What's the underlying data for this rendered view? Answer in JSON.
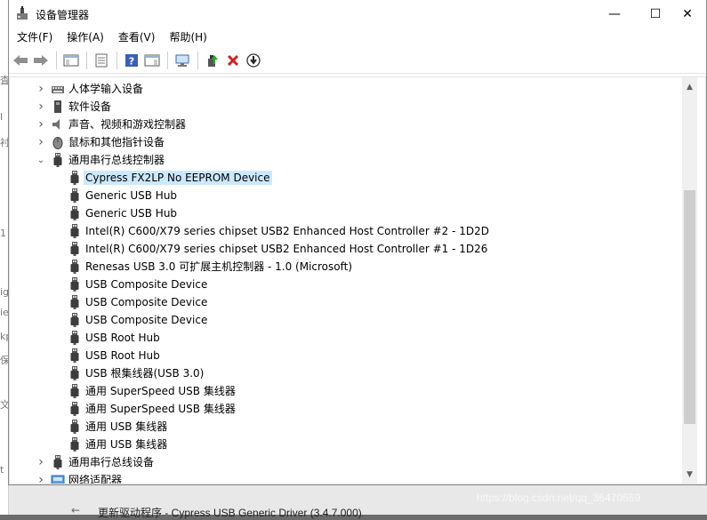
{
  "window": {
    "title": "设备管理器",
    "min_glyph": "—",
    "max_glyph": "☐",
    "close_glyph": "✕"
  },
  "menu": [
    "文件(F)",
    "操作(A)",
    "查看(V)",
    "帮助(H)"
  ],
  "toolbar": [
    "back-arrow-icon",
    "forward-arrow-icon",
    "show-hide-tree-icon",
    "properties-icon",
    "help-icon",
    "action-pane-icon",
    "scan-hardware-icon",
    "update-driver-icon",
    "uninstall-icon",
    "disable-device-icon"
  ],
  "tree": {
    "categories_above": [
      {
        "label": "人体学输入设备",
        "expanded": false,
        "icon": "hid-icon"
      },
      {
        "label": "软件设备",
        "expanded": false,
        "icon": "software-device-icon"
      },
      {
        "label": "声音、视频和游戏控制器",
        "expanded": false,
        "icon": "sound-icon"
      },
      {
        "label": "鼠标和其他指针设备",
        "expanded": false,
        "icon": "mouse-icon"
      },
      {
        "label": "通用串行总线控制器",
        "expanded": true,
        "icon": "usb-icon"
      }
    ],
    "usb_children": [
      "Cypress FX2LP No EEPROM Device",
      "Generic USB Hub",
      "Generic USB Hub",
      "Intel(R) C600/X79 series chipset USB2 Enhanced Host Controller #2 - 1D2D",
      "Intel(R) C600/X79 series chipset USB2 Enhanced Host Controller #1 - 1D26",
      "Renesas USB 3.0 可扩展主机控制器 - 1.0 (Microsoft)",
      "USB Composite Device",
      "USB Composite Device",
      "USB Composite Device",
      "USB Root Hub",
      "USB Root Hub",
      "USB 根集线器(USB 3.0)",
      "通用 SuperSpeed USB 集线器",
      "通用 SuperSpeed USB 集线器",
      "通用 USB 集线器",
      "通用 USB 集线器"
    ],
    "selected_index": 0,
    "categories_below": [
      {
        "label": "通用串行总线设备",
        "expanded": false,
        "icon": "usb-icon"
      },
      {
        "label": "网络适配器",
        "expanded": false,
        "icon": "network-adapter-icon"
      }
    ]
  },
  "background": {
    "task_text": "更新驱动程序 - Cypress USB Generic Driver (3.4.7.000)",
    "arrow": "←",
    "left_chars": [
      "査",
      "I",
      "衬",
      "1",
      "ig",
      "ie",
      "kp",
      "保",
      "文",
      "t"
    ]
  },
  "watermark": "https://blog.csdn.net/qq_36470569"
}
